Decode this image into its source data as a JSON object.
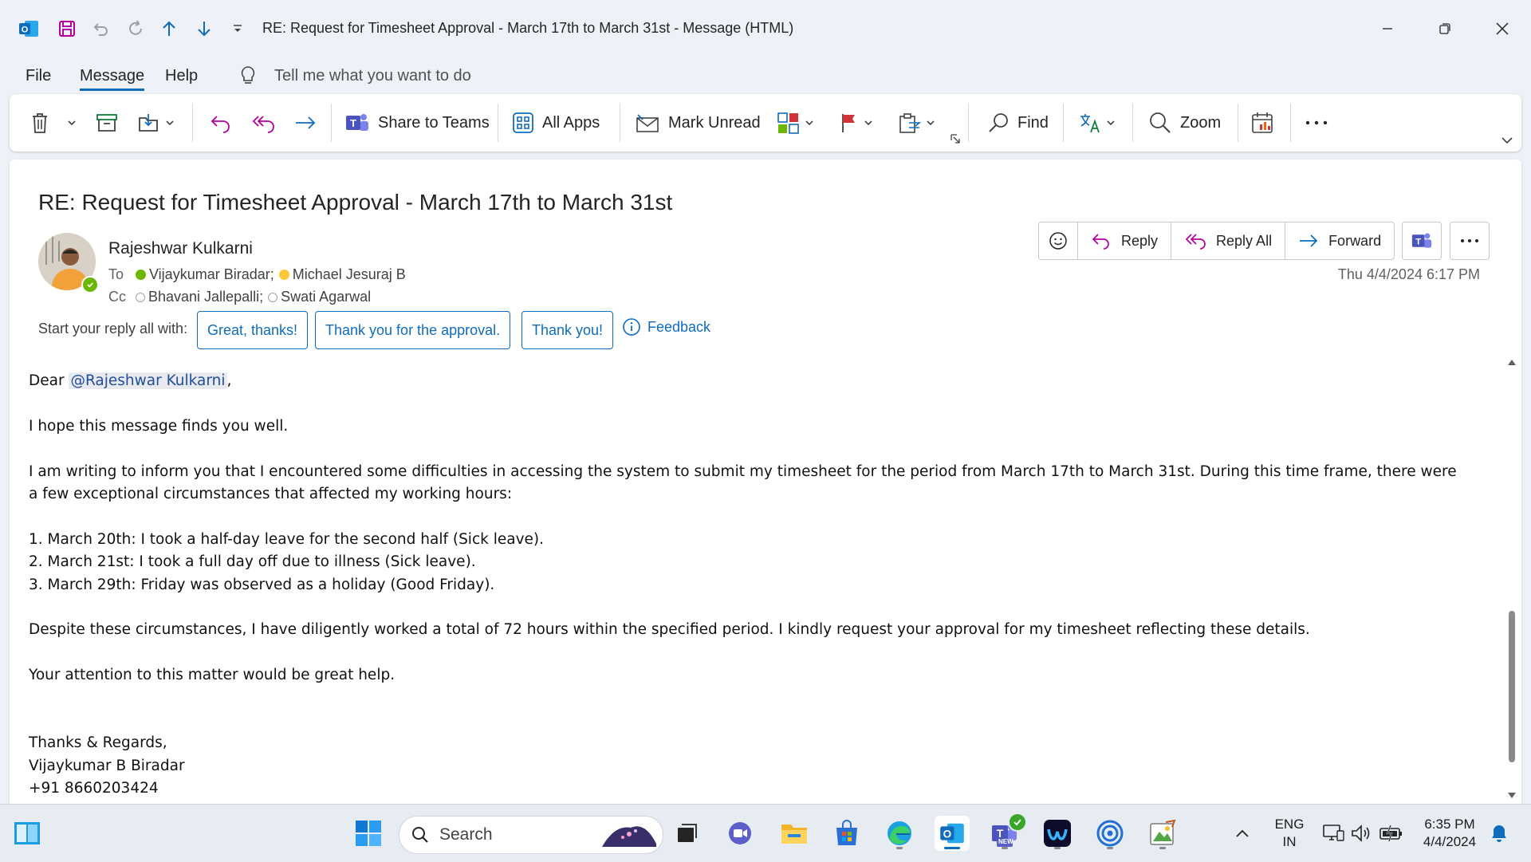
{
  "window": {
    "title": "RE: Request for Timesheet Approval - March 17th to March 31st  -  Message (HTML)"
  },
  "menu": {
    "file": "File",
    "message": "Message",
    "help": "Help",
    "tell_me": "Tell me what you want to do"
  },
  "ribbon": {
    "share_to_teams": "Share to Teams",
    "all_apps": "All Apps",
    "mark_unread": "Mark Unread",
    "find": "Find",
    "zoom": "Zoom"
  },
  "email": {
    "subject": "RE: Request for Timesheet Approval - March 17th to March 31st",
    "sender": "Rajeshwar Kulkarni",
    "to_label": "To",
    "cc_label": "Cc",
    "to": [
      {
        "name": "Vijaykumar Biradar;",
        "status": "available"
      },
      {
        "name": "Michael Jesuraj B",
        "status": "away"
      }
    ],
    "cc": [
      {
        "name": "Bhavani Jallepalli;",
        "status": "unknown"
      },
      {
        "name": "Swati Agarwal",
        "status": "unknown"
      }
    ],
    "date": "Thu 4/4/2024 6:17 PM",
    "actions": {
      "reply": "Reply",
      "reply_all": "Reply All",
      "forward": "Forward"
    },
    "suggested_replies": {
      "label": "Start your reply all with:",
      "items": [
        "Great, thanks!",
        "Thank you for the approval.",
        "Thank you!"
      ],
      "feedback": "Feedback"
    },
    "body": {
      "greeting_prefix": "Dear ",
      "mention": "@Rajeshwar Kulkarni",
      "greeting_suffix": ",",
      "p1": "I hope this message finds you well.",
      "p2": "I am writing to inform you that I encountered some difficulties in accessing the system to submit my timesheet for the period from March 17th to March 31st. During this time frame, there were a few exceptional circumstances that affected my working hours:",
      "list": [
        "1. March 20th: I took a half-day leave for the second half (Sick leave).",
        "2. March 21st: I took a full day off due to illness (Sick leave).",
        "3. March 29th: Friday was observed as a holiday (Good Friday)."
      ],
      "p3": "Despite these circumstances, I have diligently worked a total of 72 hours within the specified period. I kindly request your approval for my timesheet reflecting these details.",
      "p4": "Your attention to this matter would be great help.",
      "signature": [
        "Thanks & Regards,",
        "Vijaykumar B Biradar",
        "+91 8660203424"
      ]
    }
  },
  "taskbar": {
    "search": "Search",
    "lang_1": "ENG",
    "lang_2": "IN",
    "time": "6:35 PM",
    "date": "4/4/2024",
    "teams_badge": "NEW"
  },
  "colors": {
    "accent": "#0f6cbd",
    "available": "#6bb700",
    "away": "#fcc83a",
    "outlook_blue": "#0f6cbd",
    "flag_red": "#d13438"
  }
}
